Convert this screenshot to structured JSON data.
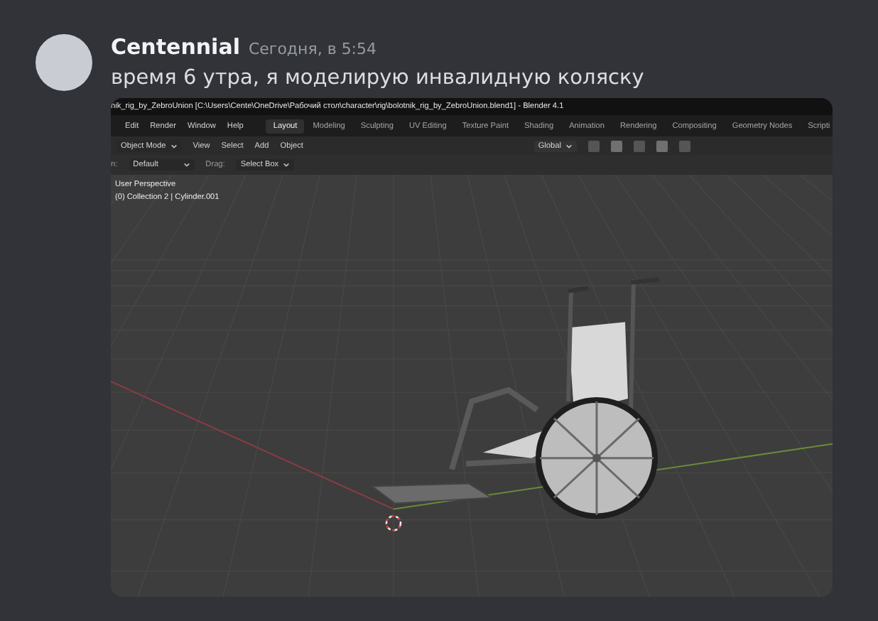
{
  "message": {
    "author": "Centennial",
    "timestamp": "Сегодня, в 5:54",
    "text": "время 6 утра, я моделирую инвалидную коляску"
  },
  "screenshot": {
    "title_bar": "nik_rig_by_ZebroUnion [C:\\Users\\Cente\\OneDrive\\Рабочий стол\\character\\rig\\bolotnik_rig_by_ZebroUnion.blend1] - Blender 4.1",
    "menu": [
      "Edit",
      "Render",
      "Window",
      "Help"
    ],
    "workspaces": [
      {
        "label": "Layout",
        "selected": true
      },
      {
        "label": "Modeling",
        "selected": false
      },
      {
        "label": "Sculpting",
        "selected": false
      },
      {
        "label": "UV Editing",
        "selected": false
      },
      {
        "label": "Texture Paint",
        "selected": false
      },
      {
        "label": "Shading",
        "selected": false
      },
      {
        "label": "Animation",
        "selected": false
      },
      {
        "label": "Rendering",
        "selected": false
      },
      {
        "label": "Compositing",
        "selected": false
      },
      {
        "label": "Geometry Nodes",
        "selected": false
      },
      {
        "label": "Scripti",
        "selected": false
      }
    ],
    "header": {
      "mode": "Object Mode",
      "menu": [
        "View",
        "Select",
        "Add",
        "Object"
      ],
      "orientation": "Global"
    },
    "tool_settings": {
      "orientation_label": "n:",
      "orientation": "Default",
      "drag_label": "Drag:",
      "drag": "Select Box"
    },
    "viewport": {
      "view_name": "User Perspective",
      "object_info": "(0) Collection 2 | Cylinder.001"
    }
  }
}
